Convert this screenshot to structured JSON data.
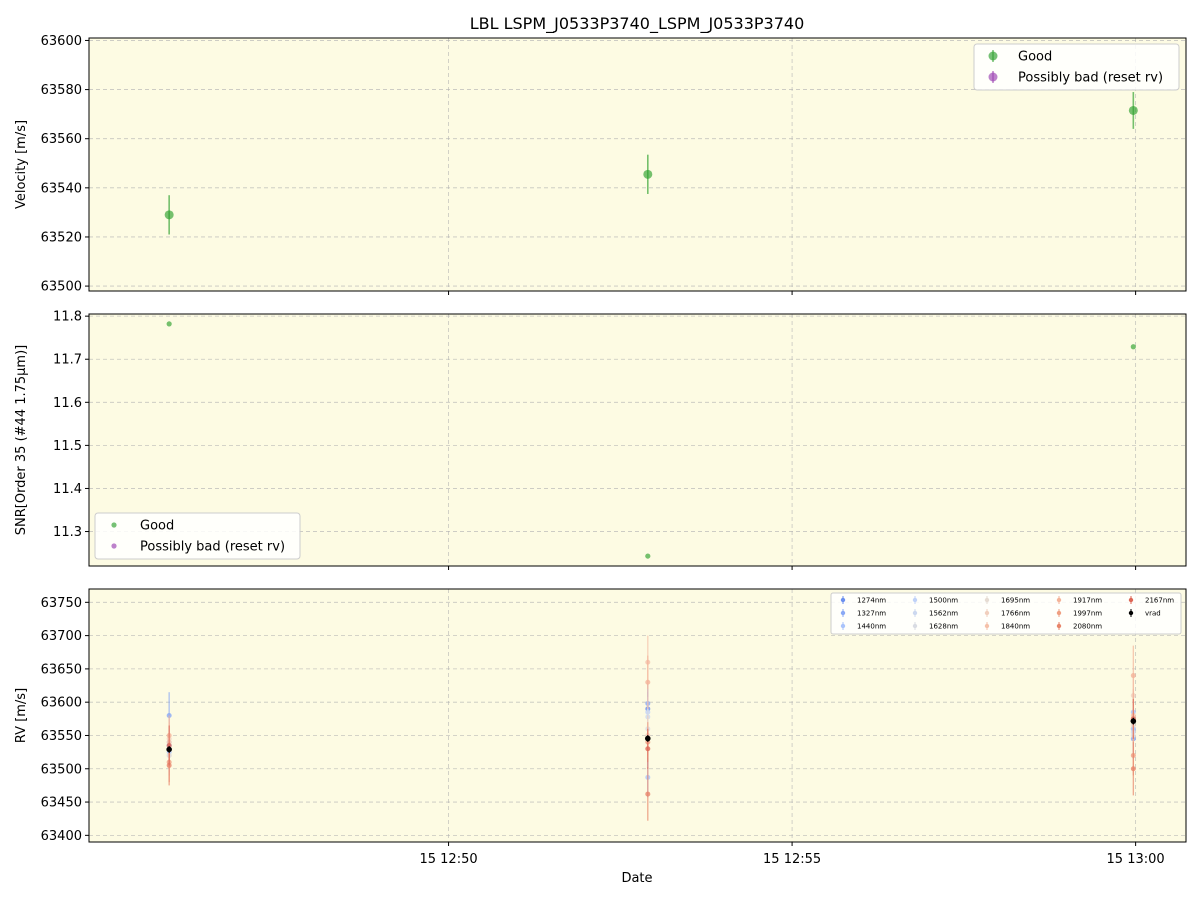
{
  "title": "LBL LSPM_J0533P3740_LSPM_J0533P3740",
  "xlabel": "Date",
  "x_ticks": [
    "15 12:50",
    "15 12:55",
    "15 13:00"
  ],
  "colors": {
    "background": "#fdfbe3",
    "good": "#2ca02c",
    "bad": "#9a3fb0",
    "vrad": "#000000"
  },
  "chart_data": [
    {
      "type": "scatter",
      "panel": "velocity",
      "ylabel": "Velocity [m/s]",
      "ylim": [
        63498,
        63601
      ],
      "yticks": [
        63500,
        63520,
        63540,
        63560,
        63580,
        63600
      ],
      "xlim": [
        "2024-01-15T12:44:46",
        "2024-01-15T13:00:44"
      ],
      "grid": true,
      "legend_position": "top-right",
      "series": [
        {
          "name": "Good",
          "points": [
            {
              "x": "2024-01-15T12:45:56",
              "y": 63529,
              "err": 8
            },
            {
              "x": "2024-01-15T12:52:54",
              "y": 63545.5,
              "err": 8
            },
            {
              "x": "2024-01-15T12:59:58",
              "y": 63571.5,
              "err": 7.5
            }
          ]
        },
        {
          "name": "Possibly bad (reset rv)",
          "points": []
        }
      ]
    },
    {
      "type": "scatter",
      "panel": "snr",
      "ylabel": "SNR[Order 35 (#44 1.75μm)]",
      "ylim": [
        11.22,
        11.805
      ],
      "yticks": [
        11.3,
        11.4,
        11.5,
        11.6,
        11.7,
        11.8
      ],
      "grid": true,
      "legend_position": "bottom-left",
      "series": [
        {
          "name": "Good",
          "points": [
            {
              "x": "2024-01-15T12:45:56",
              "y": 11.782
            },
            {
              "x": "2024-01-15T12:52:54",
              "y": 11.243
            },
            {
              "x": "2024-01-15T12:59:58",
              "y": 11.729
            }
          ]
        },
        {
          "name": "Possibly bad (reset rv)",
          "points": []
        }
      ]
    },
    {
      "type": "scatter",
      "panel": "rv",
      "ylabel": "RV [m/s]",
      "ylim": [
        63390,
        63770
      ],
      "yticks": [
        63400,
        63450,
        63500,
        63550,
        63600,
        63650,
        63700,
        63750
      ],
      "grid": true,
      "legend_position": "top-right",
      "x": [
        "2024-01-15T12:45:56",
        "2024-01-15T12:52:54",
        "2024-01-15T12:59:58"
      ],
      "series": [
        {
          "name": "1274nm",
          "color": "#6b8fef",
          "values": [
            63535,
            63590,
            63560
          ],
          "err": [
            25,
            25,
            25
          ]
        },
        {
          "name": "1327nm",
          "color": "#8aa9f5",
          "values": [
            63580,
            63598,
            63545
          ],
          "err": [
            35,
            30,
            30
          ]
        },
        {
          "name": "1440nm",
          "color": "#aac4fb",
          "values": [
            63525,
            63487,
            63585
          ],
          "err": [
            30,
            30,
            30
          ]
        },
        {
          "name": "1500nm",
          "color": "#c0d2f8",
          "values": [
            63540,
            63585,
            63560
          ],
          "err": [
            30,
            30,
            30
          ]
        },
        {
          "name": "1562nm",
          "color": "#ccd8ef",
          "values": [
            63520,
            63578,
            63555
          ],
          "err": [
            30,
            30,
            30
          ]
        },
        {
          "name": "1628nm",
          "color": "#d9dce3",
          "values": [
            63530,
            63560,
            63550
          ],
          "err": [
            30,
            30,
            30
          ]
        },
        {
          "name": "1695nm",
          "color": "#e6dcd3",
          "values": [
            63520,
            63545,
            63565
          ],
          "err": [
            30,
            30,
            30
          ]
        },
        {
          "name": "1766nm",
          "color": "#f1cfbd",
          "values": [
            63545,
            63550,
            63610
          ],
          "err": [
            30,
            30,
            30
          ]
        },
        {
          "name": "1840nm",
          "color": "#f5c1a9",
          "values": [
            63540,
            63660,
            63580
          ],
          "err": [
            30,
            40,
            40
          ]
        },
        {
          "name": "1917nm",
          "color": "#f4b399",
          "values": [
            63550,
            63630,
            63640
          ],
          "err": [
            30,
            40,
            45
          ]
        },
        {
          "name": "1997nm",
          "color": "#ef9f82",
          "values": [
            63510,
            63540,
            63520
          ],
          "err": [
            30,
            30,
            30
          ]
        },
        {
          "name": "2080nm",
          "color": "#e8856a",
          "values": [
            63505,
            63462,
            63500
          ],
          "err": [
            30,
            40,
            40
          ]
        },
        {
          "name": "2167nm",
          "color": "#dd6655",
          "values": [
            63535,
            63530,
            63575
          ],
          "err": [
            30,
            30,
            30
          ]
        },
        {
          "name": "vrad",
          "color": "#000000",
          "values": [
            63529,
            63545.5,
            63571.5
          ],
          "err": [
            5,
            5,
            5
          ]
        }
      ]
    }
  ]
}
